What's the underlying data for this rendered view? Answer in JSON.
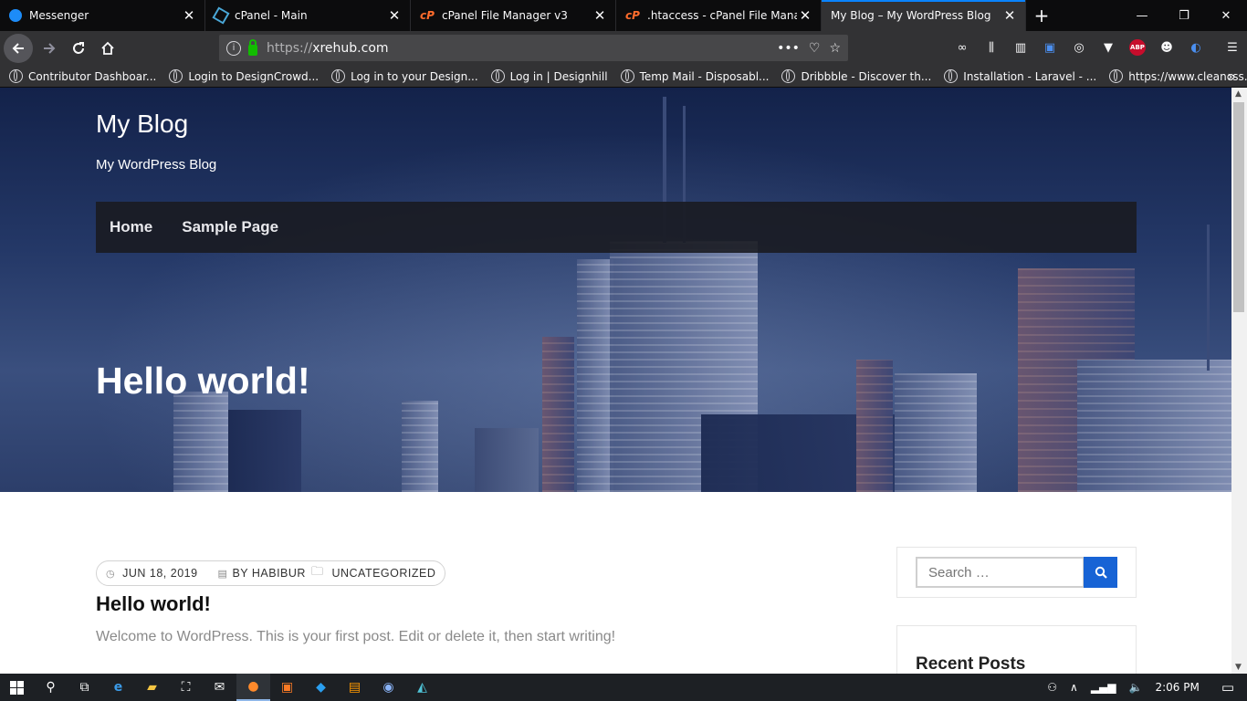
{
  "tabs": [
    {
      "title": "Messenger",
      "icon": "messenger-icon"
    },
    {
      "title": "cPanel - Main",
      "icon": "cpanel-icon"
    },
    {
      "title": "cPanel File Manager v3",
      "icon": "cpanel-icon"
    },
    {
      "title": ".htaccess - cPanel File Manager",
      "icon": "cpanel-icon"
    },
    {
      "title": "My Blog – My WordPress Blog",
      "icon": "",
      "active": true
    }
  ],
  "url": {
    "protocol": "https://",
    "host": "xrehub.com"
  },
  "bookmarks": [
    "Contributor Dashboar...",
    "Login to DesignCrowd...",
    "Log in to your Design...",
    "Log in | Designhill",
    "Temp Mail - Disposabl...",
    "Dribbble - Discover th...",
    "Installation - Laravel - ...",
    "https://www.cleancss...."
  ],
  "site": {
    "title": "My Blog",
    "description": "My WordPress Blog",
    "menu": [
      "Home",
      "Sample Page"
    ],
    "hero_title": "Hello world!"
  },
  "post": {
    "date": "JUN 18, 2019",
    "author": "BY HABIBUR",
    "category": "UNCATEGORIZED",
    "title": "Hello world!",
    "excerpt": "Welcome to WordPress. This is your first post. Edit or delete it, then start writing!"
  },
  "sidebar": {
    "search_placeholder": "Search …",
    "recent_heading": "Recent Posts"
  },
  "taskbar": {
    "time": "2:06 PM"
  },
  "colors": {
    "accent": "#0a84ff",
    "search_button": "#1763d5"
  }
}
